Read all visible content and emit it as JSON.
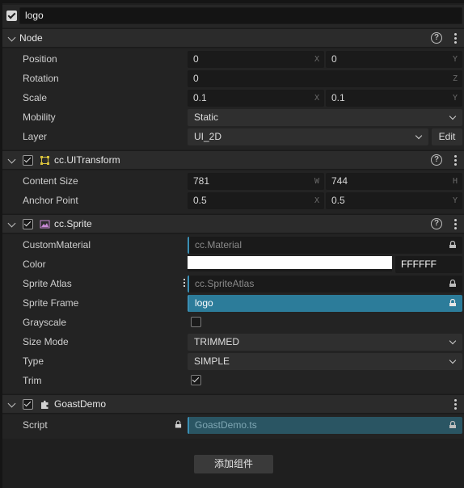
{
  "node_name": "logo",
  "node": {
    "title": "Node",
    "position": {
      "label": "Position",
      "x": "0",
      "y": "0",
      "ax": "X",
      "ay": "Y"
    },
    "rotation": {
      "label": "Rotation",
      "z": "0",
      "az": "Z"
    },
    "scale": {
      "label": "Scale",
      "x": "0.1",
      "y": "0.1",
      "ax": "X",
      "ay": "Y"
    },
    "mobility": {
      "label": "Mobility",
      "value": "Static"
    },
    "layer": {
      "label": "Layer",
      "value": "UI_2D",
      "edit": "Edit"
    }
  },
  "transform": {
    "title": "cc.UITransform",
    "content_size": {
      "label": "Content Size",
      "w": "781",
      "h": "744",
      "aw": "W",
      "ah": "H"
    },
    "anchor": {
      "label": "Anchor Point",
      "x": "0.5",
      "y": "0.5",
      "ax": "X",
      "ay": "Y"
    }
  },
  "sprite": {
    "title": "cc.Sprite",
    "custom_material": {
      "label": "CustomMaterial",
      "value": "cc.Material"
    },
    "color": {
      "label": "Color",
      "hex": "FFFFFF",
      "swatch": "#ffffff"
    },
    "atlas": {
      "label": "Sprite Atlas",
      "value": "cc.SpriteAtlas"
    },
    "frame": {
      "label": "Sprite Frame",
      "value": "logo"
    },
    "grayscale": {
      "label": "Grayscale",
      "checked": false
    },
    "size_mode": {
      "label": "Size Mode",
      "value": "TRIMMED"
    },
    "type": {
      "label": "Type",
      "value": "SIMPLE"
    },
    "trim": {
      "label": "Trim",
      "checked": true
    }
  },
  "goast": {
    "title": "GoastDemo",
    "script": {
      "label": "Script",
      "value": "GoastDemo.ts"
    }
  },
  "add_component": "添加组件",
  "colors": {
    "accent": "#3a8fb4",
    "selected": "#2c7c9a",
    "bg": "#1f1f1f"
  }
}
